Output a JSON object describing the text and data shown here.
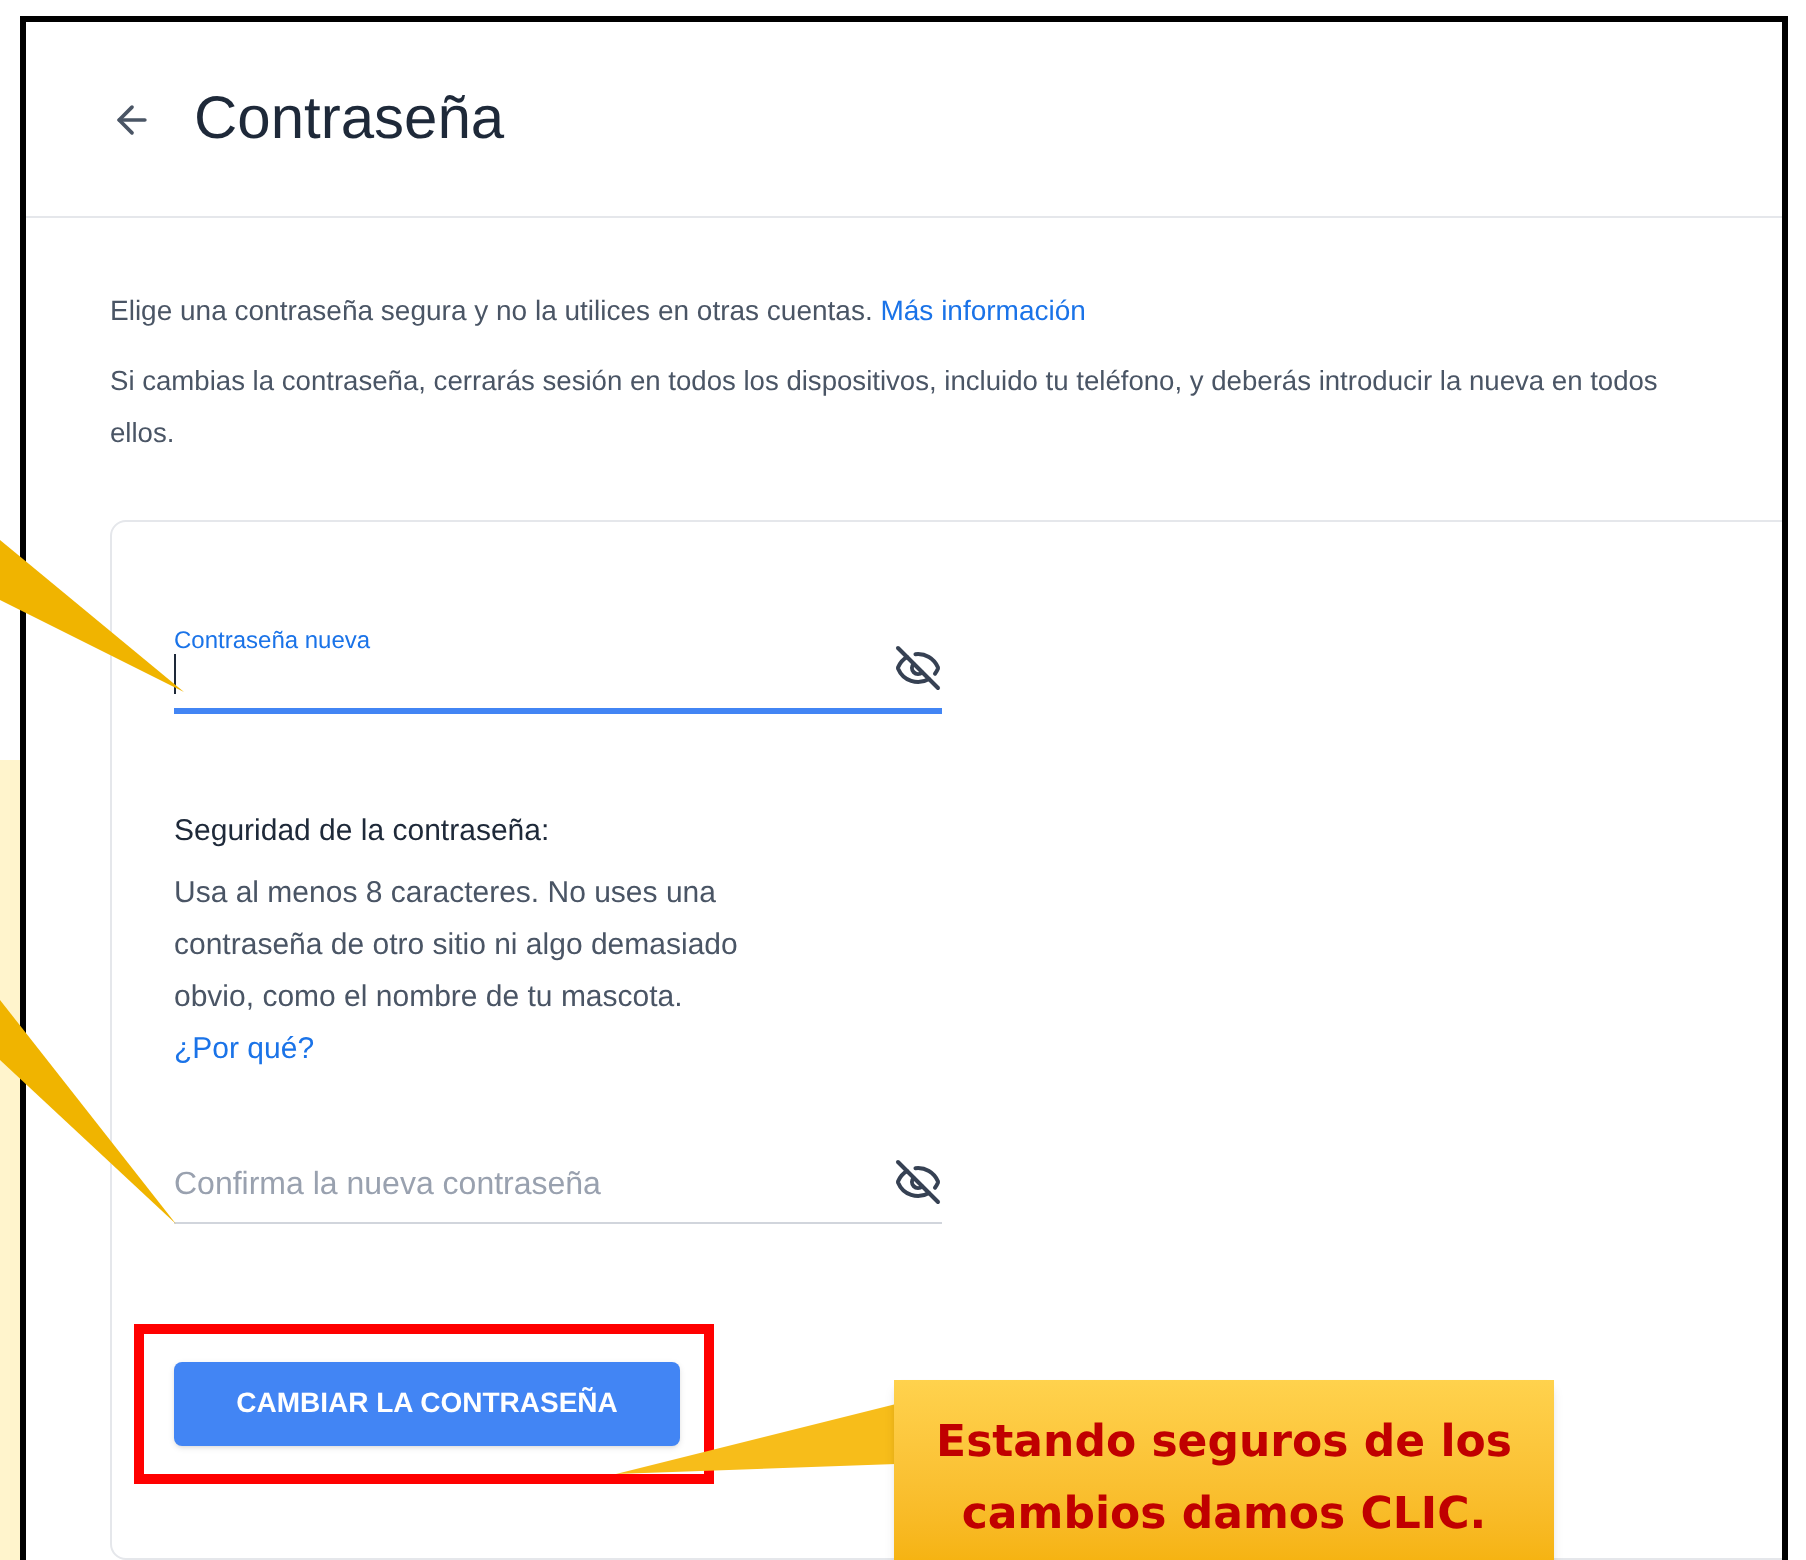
{
  "header": {
    "title": "Contraseña"
  },
  "intro": {
    "text": "Elige una contraseña segura y no la utilices en otras cuentas.",
    "link": "Más información"
  },
  "warning": "Si cambias la contraseña, cerrarás sesión en todos los dispositivos, incluido tu teléfono, y deberás introducir la nueva en todos ellos.",
  "form": {
    "new_password": {
      "label": "Contraseña nueva",
      "focused": true
    },
    "strength": {
      "title": "Seguridad de la contraseña:",
      "text": "Usa al menos 8 caracteres. No uses una contraseña de otro sitio ni algo demasiado obvio, como el nombre de tu mascota.",
      "link": "¿Por qué?"
    },
    "confirm_password": {
      "placeholder": "Confirma la nueva contraseña",
      "focused": false
    },
    "submit": "CAMBIAR LA CONTRASEÑA"
  },
  "annotation": {
    "text": "Estando seguros de los cambios damos CLIC."
  }
}
